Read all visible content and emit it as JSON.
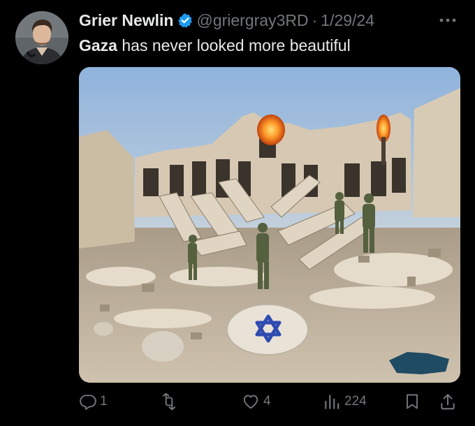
{
  "post": {
    "author_name": "Grier Newlin",
    "handle": "@griergray3RD",
    "separator": "·",
    "date": "1/29/24",
    "text_bold": "Gaza",
    "text_rest": " has never looked more beautiful"
  },
  "icons": {
    "more": "more-icon",
    "verified": "verified-badge-icon",
    "reply": "reply-icon",
    "repost": "repost-icon",
    "like": "like-icon",
    "views": "views-icon",
    "bookmark": "bookmark-icon",
    "share": "share-icon"
  },
  "actions": {
    "replies": "1",
    "reposts": "",
    "likes": "4",
    "views": "224"
  },
  "colors": {
    "background": "#000000",
    "text_primary": "#e7e9ea",
    "text_secondary": "#71767b",
    "verified_blue": "#1d9bf0"
  }
}
